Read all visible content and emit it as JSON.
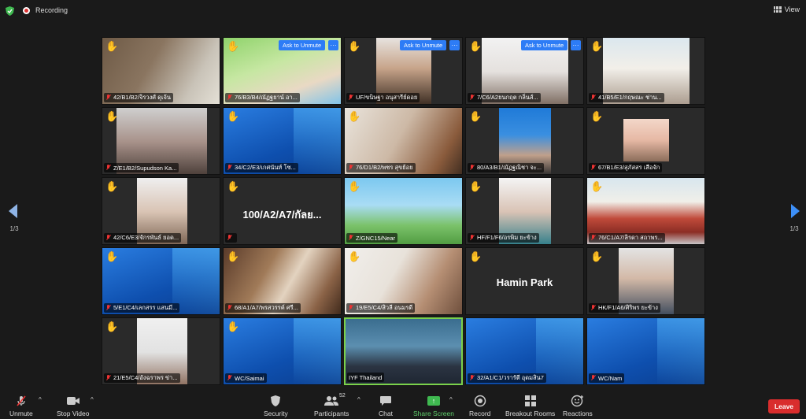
{
  "topbar": {
    "recording_label": "Recording",
    "view_label": "View"
  },
  "pager": {
    "left": "1/3",
    "right": "1/3"
  },
  "tile_buttons": {
    "ask_to_unmute": "Ask to Unmute",
    "more": "···"
  },
  "tiles": [
    {
      "name": "42/B1/B2/จิรวงศ์ ดุเจ้น",
      "hand": true
    },
    {
      "name": "76/B3/B4/ณัฏฐยาน์ อา...",
      "hand": true
    },
    {
      "name": "UF/ขนิษฐา อนุสารีย์ดอย",
      "hand": true
    },
    {
      "name": "7/C6/A2ยนกฤต กลิ่นส์...",
      "hand": true
    },
    {
      "name": "41/B5/E1/กฤษณะ ช่าน...",
      "hand": true
    },
    {
      "name": "Z/E1/B2/Supudson Ka...",
      "hand": true
    },
    {
      "name": "34/C2/E3/เกศนันท์ โซ...",
      "hand": true
    },
    {
      "name": "76/D1/B2/พชร สุขย้อย",
      "hand": true
    },
    {
      "name": "80/A3/B1/ณัฏฐณิชา จะ...",
      "hand": true
    },
    {
      "name": "67/B1/E3/สุภัสสร เสือจัก",
      "hand": true
    },
    {
      "name": "42/C6/E3/จักรพันธ์ ยอด...",
      "hand": true
    },
    {
      "name": "100/A2/A7/กัลย...",
      "hand": true
    },
    {
      "name": "Z/GNC15/Near",
      "hand": true
    },
    {
      "name": "HF/F1/F6/อรพิม ยะข้าง",
      "hand": true
    },
    {
      "name": "76/C1/A7/ลิรดา สถาพร...",
      "hand": true
    },
    {
      "name": "5/E1/C4/เลกสรร แสนมี...",
      "hand": true
    },
    {
      "name": "68/A1/A7/พรสวรรค์ ศรี...",
      "hand": true
    },
    {
      "name": "19/E5/C4/สิวลี อนมรดี",
      "hand": true
    },
    {
      "name": "Hamin Park",
      "hand": true
    },
    {
      "name": "HK/F1/A6/ศิริพร ยะข้าง",
      "hand": true
    },
    {
      "name": "21/E5/C4/อังฉราพร ข่า...",
      "hand": true
    },
    {
      "name": "WC/Saimai",
      "hand": true
    },
    {
      "name": "IYF Thailand",
      "hand": false
    },
    {
      "name": "32/A1/C1/วรารัตี อุดมสิน7",
      "hand": false
    },
    {
      "name": "WC/Nam",
      "hand": false
    }
  ],
  "toolbar": {
    "unmute": "Unmute",
    "stop_video": "Stop Video",
    "security": "Security",
    "participants": "Participants",
    "participants_count": "52",
    "chat": "Chat",
    "share_screen": "Share Screen",
    "record": "Record",
    "breakout_rooms": "Breakout Rooms",
    "reactions": "Reactions",
    "leave": "Leave"
  },
  "colors": {
    "accent_blue": "#2d7cf6",
    "leave_red": "#d92d2d",
    "share_green": "#3fb950",
    "active_speaker": "#7ad14b"
  }
}
